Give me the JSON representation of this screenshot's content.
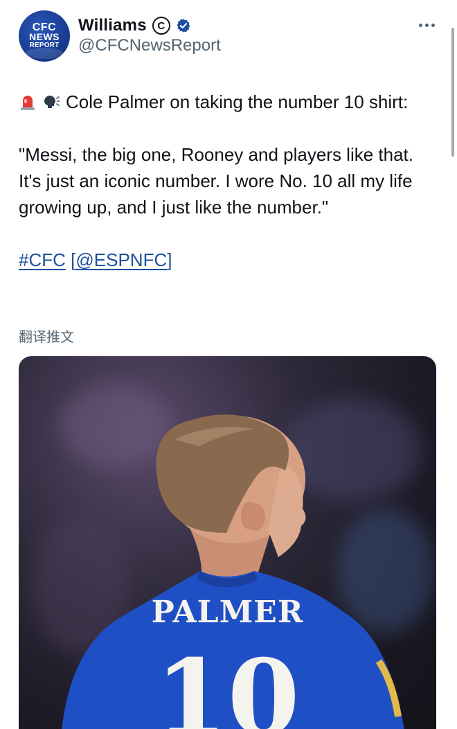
{
  "profile": {
    "avatar_lines": [
      "CFC",
      "NEWS",
      "REPORT"
    ],
    "display_name": "Williams",
    "copyright_symbol": "C",
    "handle": "@CFCNewsReport",
    "badge_color": "#1d4fa0"
  },
  "tweet": {
    "line1": "Cole Palmer on taking the number 10 shirt:",
    "quote": "\"Messi, the big one, Rooney and players like that. It's just an iconic number. I wore No. 10 all my life growing up, and I just like the number.\"",
    "hashtag": "#CFC",
    "source_open": "[",
    "source_mention": "@ESPNFC",
    "source_close": "]",
    "emojis": [
      "rotating-light-emoji",
      "speaking-head-emoji"
    ]
  },
  "translate_label": "翻译推文",
  "media": {
    "jersey_name": "PALMER",
    "jersey_number": "10",
    "jersey_color": "#1f4fc4"
  }
}
